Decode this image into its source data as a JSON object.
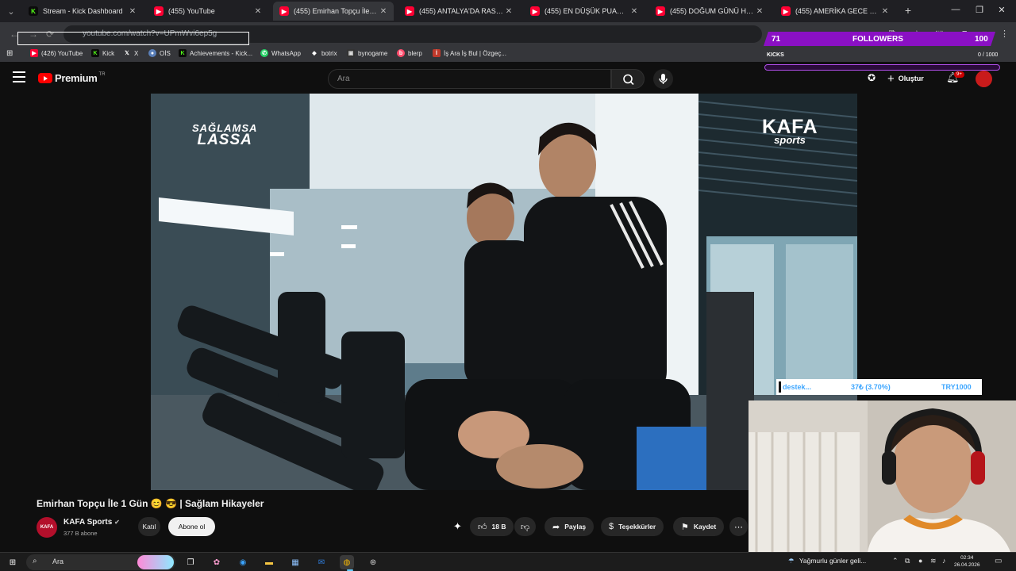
{
  "browser": {
    "tabs": [
      {
        "label": "Stream - Kick Dashboard",
        "favicon": "kick-icon",
        "active": false
      },
      {
        "label": "(455) YouTube",
        "favicon": "youtube-icon",
        "active": false
      },
      {
        "label": "(455) Emirhan Topçu İle 1 Gün",
        "favicon": "youtube-icon",
        "active": true
      },
      {
        "label": "(455) ANTALYA'DA RASTGELE M",
        "favicon": "youtube-icon",
        "active": false
      },
      {
        "label": "(455) EN DÜŞÜK PUANLI YURT",
        "favicon": "youtube-icon",
        "active": false
      },
      {
        "label": "(455) DOĞUM GÜNÜ HEDİYELE",
        "favicon": "youtube-icon",
        "active": false
      },
      {
        "label": "(455) AMERİKA GECE KIYINTIS",
        "favicon": "youtube-icon",
        "active": false
      }
    ],
    "url": "youtube.com/watch?v=UPmWvi6ep5g",
    "bookmarks": [
      {
        "label": "(426) YouTube",
        "icon": "youtube-icon"
      },
      {
        "label": "Kick",
        "icon": "kick-icon"
      },
      {
        "label": "X",
        "icon": "x-icon"
      },
      {
        "label": "OİS",
        "icon": "globe-icon"
      },
      {
        "label": "Achievements - Kick...",
        "icon": "kick-icon"
      },
      {
        "label": "WhatsApp",
        "icon": "whatsapp-icon"
      },
      {
        "label": "botrix",
        "icon": "bot-icon"
      },
      {
        "label": "bynogame",
        "icon": "game-icon"
      },
      {
        "label": "blerp",
        "icon": "blerp-icon"
      },
      {
        "label": "İş Ara İş Bul | Özgeç...",
        "icon": "job-icon"
      }
    ]
  },
  "youtube": {
    "logo_text": "Premium",
    "logo_suffix": "TR",
    "search_placeholder": "Ara",
    "create_label": "Oluştur",
    "notif_badge": "9+"
  },
  "video": {
    "title": "Emirhan Topçu İle 1 Gün 😊 😎 | Sağlam Hikayeler",
    "overlay_left_top": "SAĞLAMSA",
    "overlay_left_bottom": "LASSA",
    "overlay_right_top": "KAFA",
    "overlay_right_bottom": "sports"
  },
  "channel": {
    "name": "KAFA Sports",
    "subscribers": "377 B abone",
    "avatar_text": "KAFA",
    "join_label": "Katıl",
    "subscribe_label": "Abone ol"
  },
  "actions": {
    "likes": "18 B",
    "share": "Paylaş",
    "thanks": "Teşekkürler",
    "save": "Kaydet"
  },
  "stream_overlay": {
    "followers_count": "71",
    "followers_label": "FOLLOWERS",
    "followers_goal": "100",
    "kicks_label": "KICKS",
    "kicks_count": "0 / 1000",
    "kicks_progress": 0.0,
    "donation_label": "destek...",
    "donation_progress": "37₺ (3.70%)",
    "donation_goal": "TRY1000"
  },
  "taskbar": {
    "search_placeholder": "Ara",
    "weather": "Yağmurlu günler geli...",
    "time": "02:34",
    "date": "26.04.2026"
  },
  "colors": {
    "yt_bg": "#0f0f0f",
    "yt_red": "#ff0000",
    "kick_green": "#53fc18",
    "overlay_purple": "#8a10c4",
    "donation_blue": "#3fa7ff"
  }
}
